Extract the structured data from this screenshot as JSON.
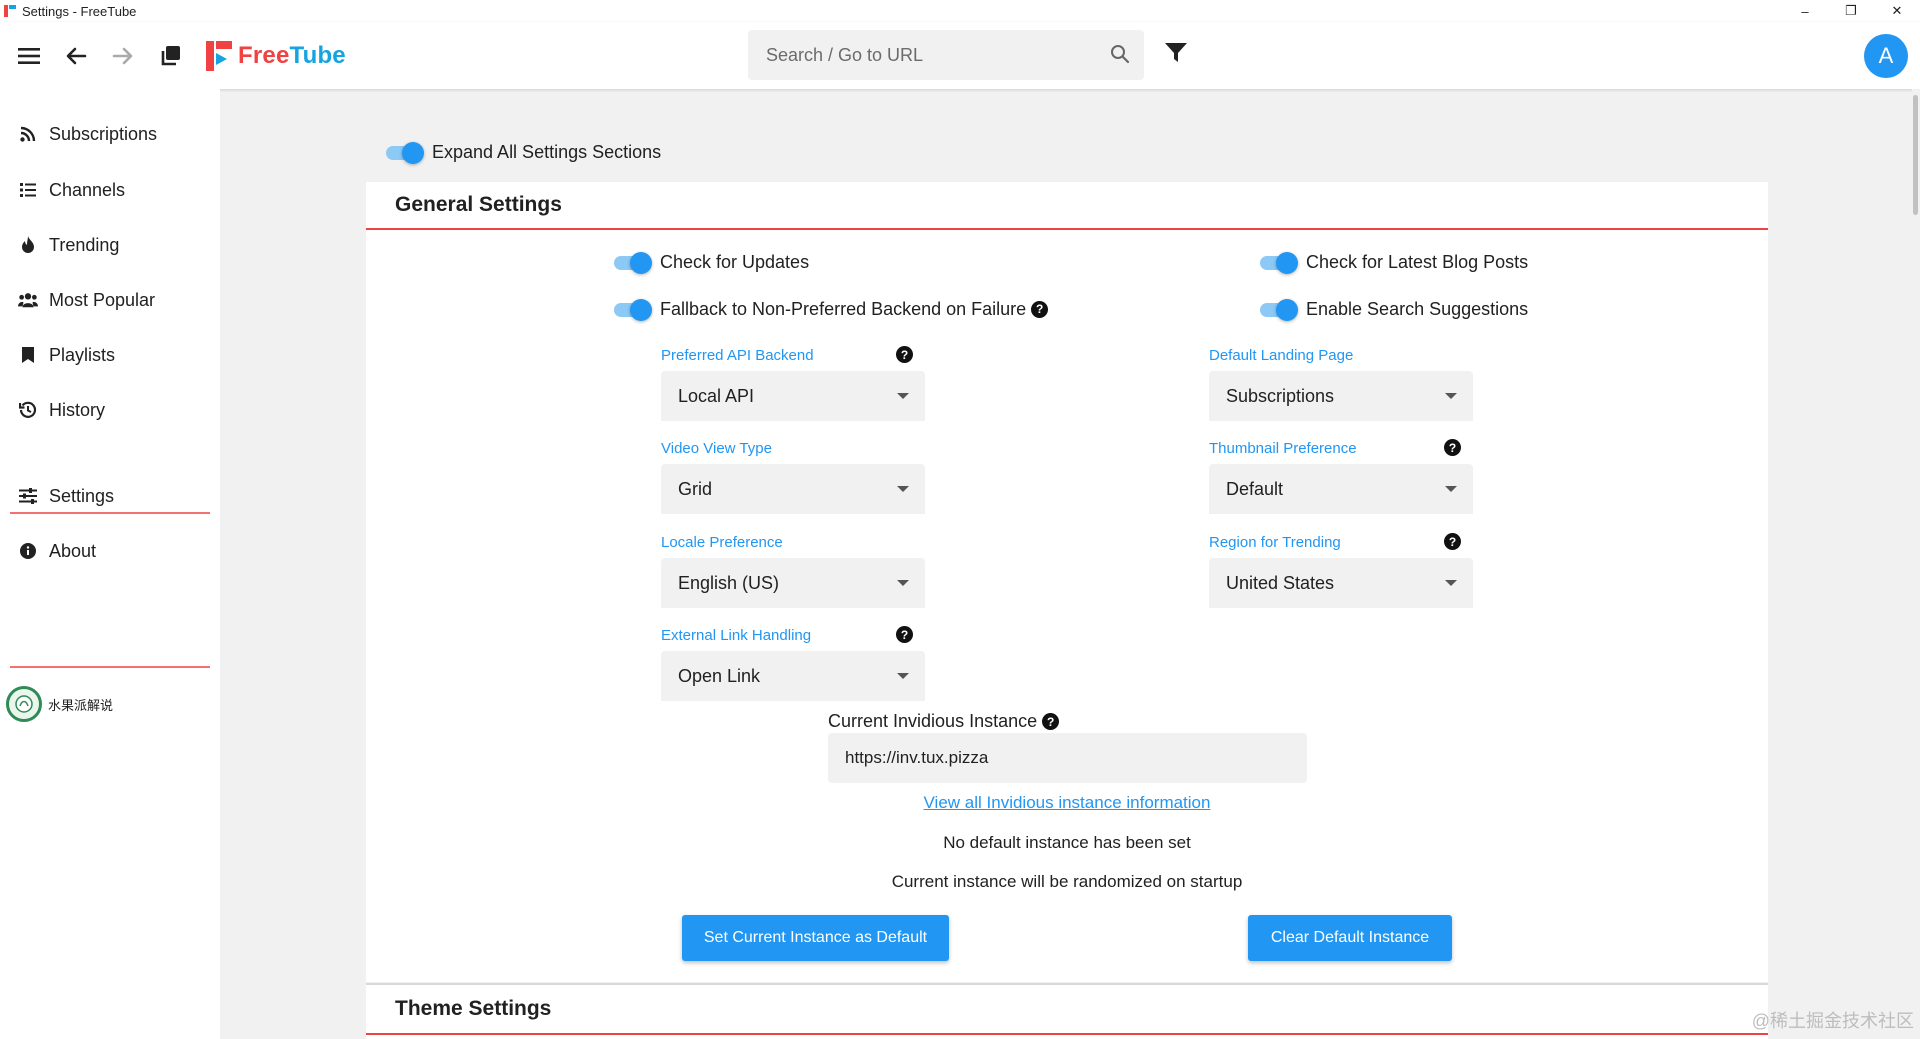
{
  "window": {
    "title": "Settings - FreeTube",
    "minimize": "–",
    "restore": "❐",
    "close": "✕"
  },
  "topnav": {
    "logo_free": "Free",
    "logo_tube": "Tube",
    "search_placeholder": "Search / Go to URL",
    "avatar_letter": "A"
  },
  "sidebar": {
    "items": [
      {
        "label": "Subscriptions",
        "icon": "rss-icon"
      },
      {
        "label": "Channels",
        "icon": "list-icon"
      },
      {
        "label": "Trending",
        "icon": "fire-icon"
      },
      {
        "label": "Most Popular",
        "icon": "users-icon"
      },
      {
        "label": "Playlists",
        "icon": "bookmark-icon"
      },
      {
        "label": "History",
        "icon": "history-icon"
      },
      {
        "label": "Settings",
        "icon": "sliders-icon"
      },
      {
        "label": "About",
        "icon": "info-icon"
      }
    ],
    "channel": {
      "name": "水果派解说"
    }
  },
  "main": {
    "expand_all_label": "Expand All Settings Sections",
    "general": {
      "title": "General Settings",
      "toggles": {
        "check_updates": "Check for Updates",
        "fallback": "Fallback to Non-Preferred Backend on Failure",
        "blog_posts": "Check for Latest Blog Posts",
        "search_suggestions": "Enable Search Suggestions"
      },
      "selects": {
        "api_backend": {
          "label": "Preferred API Backend",
          "value": "Local API"
        },
        "landing_page": {
          "label": "Default Landing Page",
          "value": "Subscriptions"
        },
        "view_type": {
          "label": "Video View Type",
          "value": "Grid"
        },
        "thumbnail": {
          "label": "Thumbnail Preference",
          "value": "Default"
        },
        "locale": {
          "label": "Locale Preference",
          "value": "English (US)"
        },
        "region": {
          "label": "Region for Trending",
          "value": "United States"
        },
        "external_link": {
          "label": "External Link Handling",
          "value": "Open Link"
        }
      },
      "invidious": {
        "label": "Current Invidious Instance",
        "value": "https://inv.tux.pizza",
        "view_all_link": "View all Invidious instance information",
        "no_default": "No default instance has been set",
        "randomized": "Current instance will be randomized on startup",
        "set_default_button": "Set Current Instance as Default",
        "clear_default_button": "Clear Default Instance"
      }
    },
    "theme": {
      "title": "Theme Settings"
    }
  },
  "watermark": "@稀土掘金技术社区",
  "colors": {
    "accent": "#2196f3",
    "brand_red": "#f04242",
    "brand_blue": "#14a4df"
  }
}
